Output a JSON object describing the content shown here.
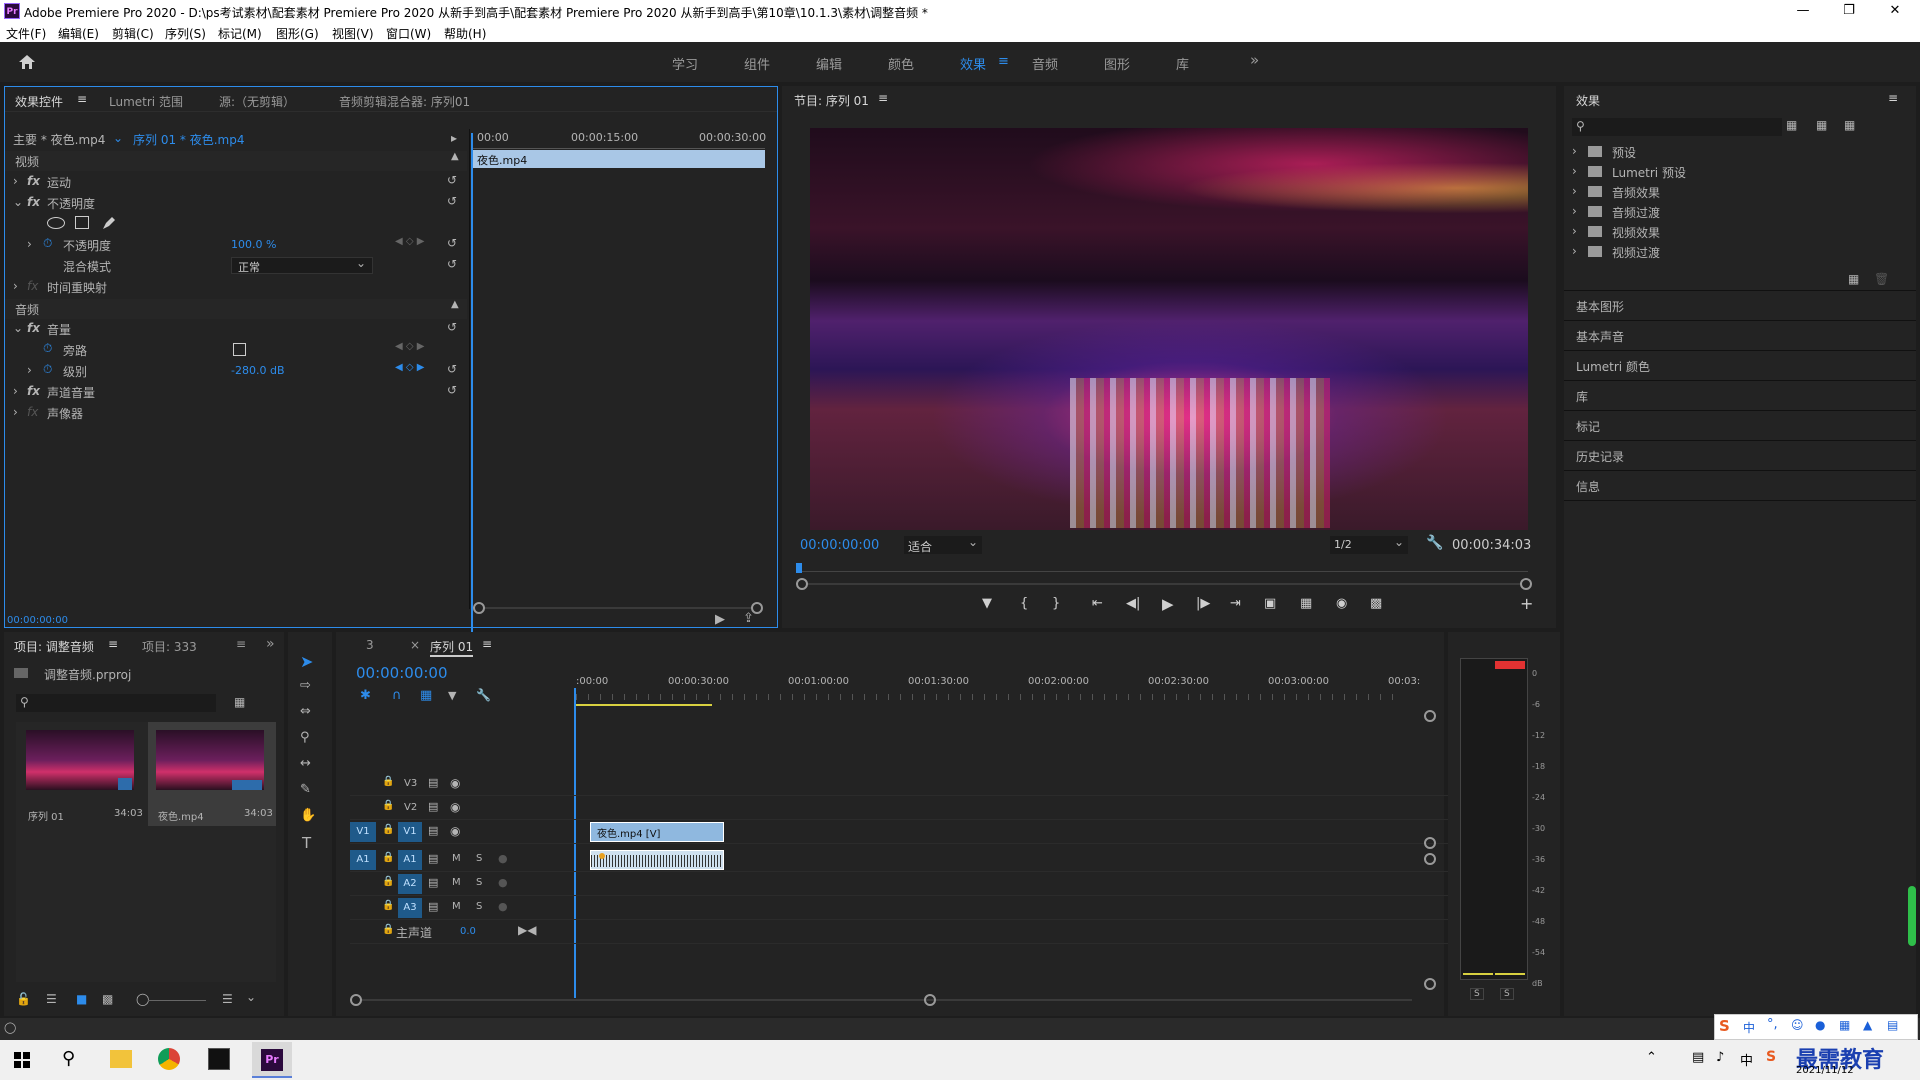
{
  "app": {
    "title": "Adobe Premiere Pro 2020 - D:\\ps考试素材\\配套素材 Premiere Pro 2020 从新手到高手\\配套素材 Premiere Pro 2020 从新手到高手\\第10章\\10.1.3\\素材\\调整音频 *",
    "logo": "Pr"
  },
  "menu": [
    "文件(F)",
    "编辑(E)",
    "剪辑(C)",
    "序列(S)",
    "标记(M)",
    "图形(G)",
    "视图(V)",
    "窗口(W)",
    "帮助(H)"
  ],
  "workspaces": [
    "学习",
    "组件",
    "编辑",
    "颜色",
    "效果",
    "音频",
    "图形",
    "库"
  ],
  "active_workspace": "效果",
  "effect_controls": {
    "tabs": [
      "效果控件",
      "Lumetri 范围",
      "源:（无剪辑）",
      "音频剪辑混合器: 序列01"
    ],
    "master": "主要 * 夜色.mp4",
    "sequence": "序列 01 * 夜色.mp4",
    "ruler": [
      "00:00",
      "00:00:15:00",
      "00:00:30:00"
    ],
    "clip_name": "夜色.mp4",
    "video_header": "视频",
    "audio_header": "音频",
    "motion": "运动",
    "opacity_group": "不透明度",
    "opacity_label": "不透明度",
    "opacity_value": "100.0 %",
    "blend_label": "混合模式",
    "blend_value": "正常",
    "time_remap": "时间重映射",
    "volume": "音量",
    "bypass": "旁路",
    "level": "级别",
    "level_value": "-280.0 dB",
    "channel_volume": "声道音量",
    "panner": "声像器",
    "timecode": "00:00:00:00"
  },
  "program": {
    "title": "节目: 序列 01",
    "timecode": "00:00:00:00",
    "fit": "适合",
    "res": "1/2",
    "duration": "00:00:34:03"
  },
  "effects_panel": {
    "title": "效果",
    "tree": [
      "预设",
      "Lumetri 预设",
      "音频效果",
      "音频过渡",
      "视频效果",
      "视频过渡"
    ],
    "sections": [
      "基本图形",
      "基本声音",
      "Lumetri 颜色",
      "库",
      "标记",
      "历史记录",
      "信息"
    ]
  },
  "project": {
    "tabs": [
      "项目: 调整音频",
      "项目: 333"
    ],
    "file": "调整音频.prproj",
    "items": [
      {
        "name": "序列 01",
        "dur": "34:03"
      },
      {
        "name": "夜色.mp4",
        "dur": "34:03"
      }
    ]
  },
  "timeline": {
    "tabs": [
      "3",
      "序列 01"
    ],
    "timecode": "00:00:00:00",
    "ruler": [
      ":00:00",
      "00:00:30:00",
      "00:01:00:00",
      "00:01:30:00",
      "00:02:00:00",
      "00:02:30:00",
      "00:03:00:00",
      "00:03:"
    ],
    "tracks_video": [
      "V3",
      "V2",
      "V1"
    ],
    "tracks_audio": [
      "A1",
      "A2",
      "A3"
    ],
    "src_v": "V1",
    "src_a": "A1",
    "master": "主声道",
    "master_val": "0.0",
    "video_clip": "夜色.mp4 [V]",
    "m": "M",
    "s": "S"
  },
  "meter": {
    "scale": [
      "0",
      "-6",
      "-12",
      "-18",
      "-24",
      "-30",
      "-36",
      "-42",
      "-48",
      "-54",
      "dB"
    ],
    "solo": [
      "S",
      "S"
    ]
  },
  "taskbar": {
    "date": "2021/11/12",
    "ime": "中",
    "watermark": "最需教育"
  },
  "colors": {
    "accent": "#2d8ceb",
    "panel": "#232323",
    "bg": "#1d1d1d",
    "clip_video": "#8fb8df",
    "clip_audio": "#cfe0ef"
  }
}
